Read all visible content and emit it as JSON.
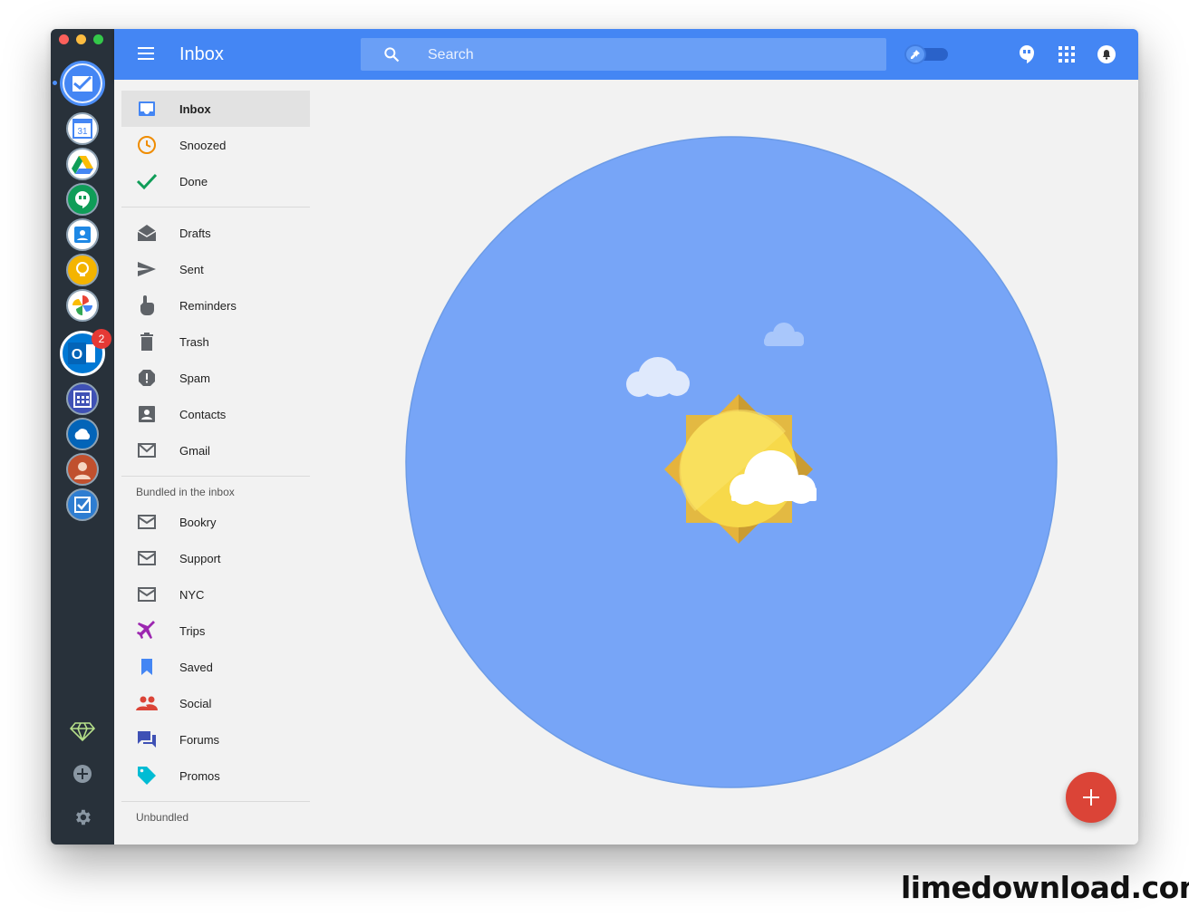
{
  "header": {
    "title": "Inbox",
    "search_placeholder": "Search"
  },
  "rail": {
    "apps": [
      {
        "name": "inbox-app"
      },
      {
        "name": "calendar-app",
        "label": "31"
      },
      {
        "name": "drive-app"
      },
      {
        "name": "hangouts-app"
      },
      {
        "name": "contacts-app"
      },
      {
        "name": "keep-app"
      },
      {
        "name": "photos-app"
      },
      {
        "name": "outlook-app",
        "label": "O",
        "badge": "2"
      },
      {
        "name": "outlook-calendar-app"
      },
      {
        "name": "onedrive-app"
      },
      {
        "name": "people-app"
      },
      {
        "name": "tasks-app"
      }
    ]
  },
  "sidebar": {
    "primary": [
      {
        "label": "Inbox",
        "icon": "inbox-icon",
        "active": true
      },
      {
        "label": "Snoozed",
        "icon": "clock-icon"
      },
      {
        "label": "Done",
        "icon": "check-icon"
      }
    ],
    "secondary": [
      {
        "label": "Drafts",
        "icon": "drafts-icon"
      },
      {
        "label": "Sent",
        "icon": "send-icon"
      },
      {
        "label": "Reminders",
        "icon": "reminder-icon"
      },
      {
        "label": "Trash",
        "icon": "trash-icon"
      },
      {
        "label": "Spam",
        "icon": "spam-icon"
      },
      {
        "label": "Contacts",
        "icon": "contacts-icon"
      },
      {
        "label": "Gmail",
        "icon": "gmail-icon"
      }
    ],
    "bundled_heading": "Bundled in the inbox",
    "bundled": [
      {
        "label": "Bookry",
        "icon": "mail-icon"
      },
      {
        "label": "Support",
        "icon": "mail-icon"
      },
      {
        "label": "NYC",
        "icon": "mail-icon"
      },
      {
        "label": "Trips",
        "icon": "plane-icon"
      },
      {
        "label": "Saved",
        "icon": "bookmark-icon"
      },
      {
        "label": "Social",
        "icon": "people-icon"
      },
      {
        "label": "Forums",
        "icon": "forum-icon"
      },
      {
        "label": "Promos",
        "icon": "tag-icon"
      }
    ],
    "unbundled_heading": "Unbundled"
  },
  "colors": {
    "topbar": "#4486f4",
    "accent_circle": "#77a5f7",
    "fab": "#db4437",
    "rail": "#28313a"
  },
  "watermark": "limedownload.com"
}
